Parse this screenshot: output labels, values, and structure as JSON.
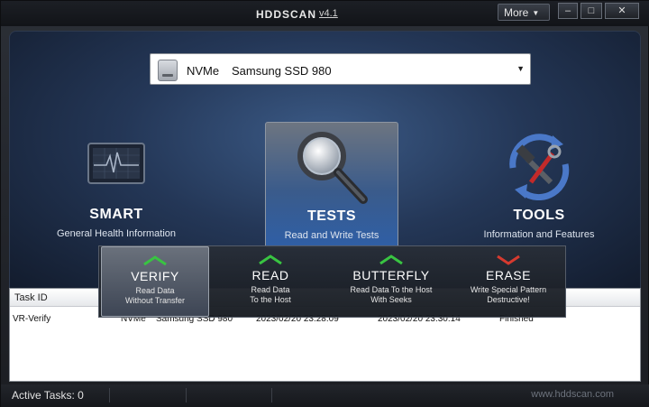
{
  "window": {
    "title": "HDDSCAN",
    "version": "v4.1",
    "more_label": "More",
    "controls": [
      "–",
      "□",
      "✕"
    ]
  },
  "drive": {
    "type": "NVMe",
    "name": "Samsung SSD 980"
  },
  "tools": [
    {
      "title": "SMART",
      "subtitle": "General Health Information",
      "icon": "heartbeat-monitor-icon"
    },
    {
      "title": "TESTS",
      "subtitle": "Read and Write Tests",
      "icon": "magnifier-icon"
    },
    {
      "title": "TOOLS",
      "subtitle": "Information and Features",
      "icon": "hammer-wrench-icon"
    }
  ],
  "test_menu": [
    {
      "title": "VERIFY",
      "line1": "Read Data",
      "line2": "Without Transfer",
      "chevron": "green"
    },
    {
      "title": "READ",
      "line1": "Read Data",
      "line2": "To the Host",
      "chevron": "green"
    },
    {
      "title": "BUTTERFLY",
      "line1": "Read Data To the Host",
      "line2": "With Seeks",
      "chevron": "green"
    },
    {
      "title": "ERASE",
      "line1": "Write Special Pattern",
      "line2": "Destructive!",
      "chevron": "red"
    }
  ],
  "task_table": {
    "headers": [
      "Task ID"
    ],
    "rows": [
      {
        "id": "VR-Verify",
        "type": "NVMe",
        "drive": "Samsung SSD 980",
        "start": "2023/02/20 23:28:09",
        "end": "2023/02/20 23:30:14",
        "state": "Finished"
      }
    ]
  },
  "status": {
    "active_tasks": "Active Tasks: 0",
    "site": "www.hddscan.com"
  },
  "colors": {
    "accent": "#3a6ab0",
    "chevron_green": "#39c442",
    "chevron_red": "#d63a2f"
  }
}
